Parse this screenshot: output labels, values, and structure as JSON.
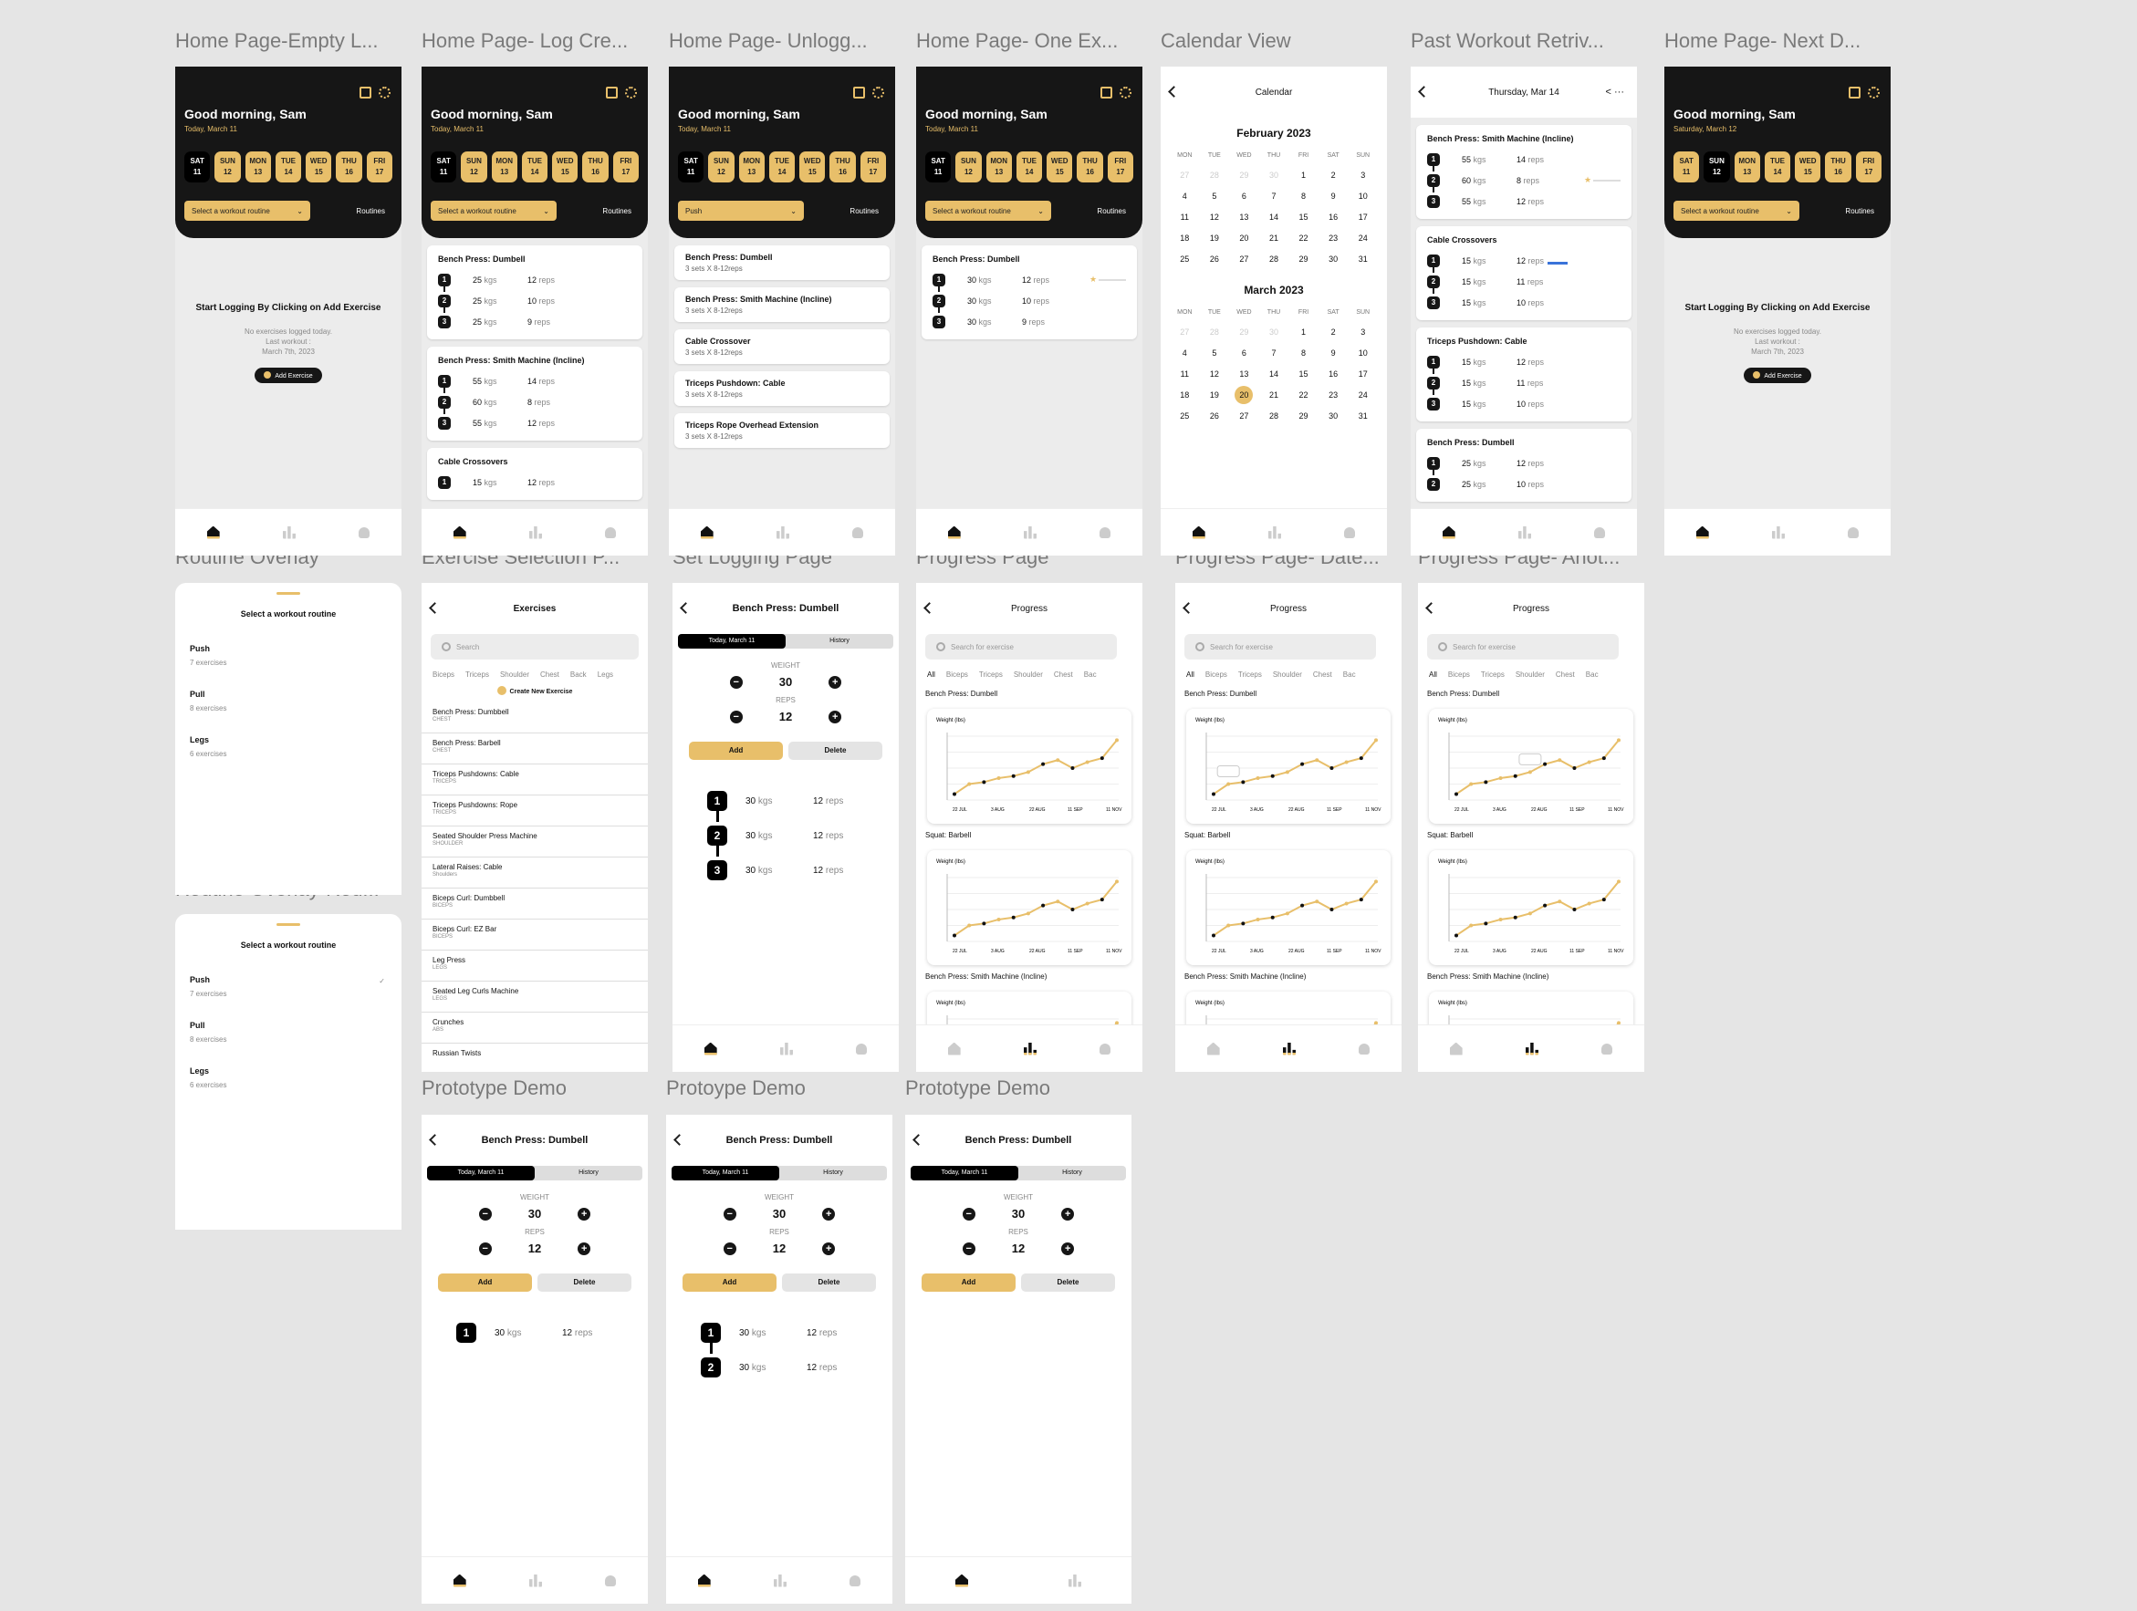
{
  "colors": {
    "accent": "#e8bf6a",
    "dark": "#161616",
    "canvas": "#e5e5e5",
    "progress_blue": "#3a73d9"
  },
  "frame_titles": {
    "home_empty": "Home Page-Empty L...",
    "home_log": "Home Page- Log Cre...",
    "home_unlogged": "Home Page- Unlogg...",
    "home_one": "Home Page- One Ex...",
    "calendar": "Calendar View",
    "past": "Past Workout Retriv...",
    "next": "Home Page- Next D...",
    "routine": "Routine Overlay",
    "routine2": "Routine Overlay-Rou...",
    "exsel": "Exercise Selection P...",
    "setlog": "Set Logging Page",
    "progress": "Progress Page",
    "progress_date": "Progress Page- Date...",
    "progress_other": "Progress Page- Anot...",
    "proto1": "Prototype Demo",
    "proto2": "Protoype Demo",
    "proto3": "Prototype Demo"
  },
  "home": {
    "greeting": "Good morning, Sam",
    "today": "Today, March 11",
    "today_next": "Saturday, March 12",
    "days": [
      {
        "dow": "SAT",
        "num": "11"
      },
      {
        "dow": "SUN",
        "num": "12"
      },
      {
        "dow": "MON",
        "num": "13"
      },
      {
        "dow": "TUE",
        "num": "14"
      },
      {
        "dow": "WED",
        "num": "15"
      },
      {
        "dow": "THU",
        "num": "16"
      },
      {
        "dow": "FRI",
        "num": "17"
      }
    ],
    "select_placeholder": "Select a workout routine",
    "select_push": "Push",
    "routines": "Routines",
    "empty_title": "Start Logging By Clicking on Add Exercise",
    "empty_note": "No exercises logged today.",
    "last_workout": "Last workout :",
    "last_date": "March 7th, 2023",
    "add_exercise": "Add Exercise",
    "unit_kgs": "kgs",
    "unit_reps": "reps"
  },
  "log": [
    {
      "name": "Bench Press: Dumbell",
      "sets": [
        {
          "n": "1",
          "w": "25",
          "r": "12"
        },
        {
          "n": "2",
          "w": "25",
          "r": "10"
        },
        {
          "n": "3",
          "w": "25",
          "r": "9"
        }
      ]
    },
    {
      "name": "Bench Press: Smith Machine (Incline)",
      "sets": [
        {
          "n": "1",
          "w": "55",
          "r": "14"
        },
        {
          "n": "2",
          "w": "60",
          "r": "8"
        },
        {
          "n": "3",
          "w": "55",
          "r": "12"
        }
      ]
    },
    {
      "name": "Cable Crossovers",
      "sets": [
        {
          "n": "1",
          "w": "15",
          "r": "12"
        }
      ]
    }
  ],
  "unlogged": [
    {
      "name": "Bench Press: Dumbell",
      "sub": "3 sets X 8-12reps"
    },
    {
      "name": "Bench Press: Smith Machine (Incline)",
      "sub": "3 sets X 8-12reps"
    },
    {
      "name": "Cable Crossover",
      "sub": "3 sets X 8-12reps"
    },
    {
      "name": "Triceps Pushdown: Cable",
      "sub": "3 sets X 8-12reps"
    },
    {
      "name": "Triceps Rope Overhead Extension",
      "sub": "3 sets X 8-12reps"
    }
  ],
  "one": {
    "name": "Bench Press: Dumbell",
    "sets": [
      {
        "n": "1",
        "w": "30",
        "r": "12"
      },
      {
        "n": "2",
        "w": "30",
        "r": "10"
      },
      {
        "n": "3",
        "w": "30",
        "r": "9"
      }
    ]
  },
  "calendar": {
    "title": "Calendar",
    "dow": [
      "MON",
      "TUE",
      "WED",
      "THU",
      "FRI",
      "SAT",
      "SUN"
    ],
    "months": [
      {
        "name": "February 2023",
        "days": [
          "27",
          "28",
          "29",
          "30",
          "1",
          "2",
          "3",
          "4",
          "5",
          "6",
          "7",
          "8",
          "9",
          "10",
          "11",
          "12",
          "13",
          "14",
          "15",
          "16",
          "17",
          "18",
          "19",
          "20",
          "21",
          "22",
          "23",
          "24",
          "25",
          "26",
          "27",
          "28",
          "29",
          "30",
          "31"
        ]
      },
      {
        "name": "March 2023",
        "days": [
          "27",
          "28",
          "29",
          "30",
          "1",
          "2",
          "3",
          "4",
          "5",
          "6",
          "7",
          "8",
          "9",
          "10",
          "11",
          "12",
          "13",
          "14",
          "15",
          "16",
          "17",
          "18",
          "19",
          "20",
          "21",
          "22",
          "23",
          "24",
          "25",
          "26",
          "27",
          "28",
          "29",
          "30",
          "31"
        ]
      }
    ]
  },
  "past": {
    "title": "Thursday, Mar 14",
    "cards": [
      {
        "name": "Bench Press: Smith Machine (Incline)",
        "sets": [
          {
            "n": "1",
            "w": "55",
            "r": "14"
          },
          {
            "n": "2",
            "w": "60",
            "r": "8"
          },
          {
            "n": "3",
            "w": "55",
            "r": "12"
          }
        ]
      },
      {
        "name": "Cable Crossovers",
        "sets": [
          {
            "n": "1",
            "w": "15",
            "r": "12"
          },
          {
            "n": "2",
            "w": "15",
            "r": "11"
          },
          {
            "n": "3",
            "w": "15",
            "r": "10"
          }
        ]
      },
      {
        "name": "Triceps Pushdown: Cable",
        "sets": [
          {
            "n": "1",
            "w": "15",
            "r": "12"
          },
          {
            "n": "2",
            "w": "15",
            "r": "11"
          },
          {
            "n": "3",
            "w": "15",
            "r": "10"
          }
        ]
      },
      {
        "name": "Bench Press: Dumbell",
        "sets": [
          {
            "n": "1",
            "w": "25",
            "r": "12"
          },
          {
            "n": "2",
            "w": "25",
            "r": "10"
          }
        ]
      }
    ]
  },
  "routine": {
    "title": "Select a workout routine",
    "options": [
      {
        "name": "Push",
        "sub": "7 exercises"
      },
      {
        "name": "Pull",
        "sub": "8 exercises"
      },
      {
        "name": "Legs",
        "sub": "6 exercises"
      }
    ]
  },
  "exercises": {
    "title": "Exercises",
    "search": "Search",
    "filters": [
      "Biceps",
      "Triceps",
      "Shoulder",
      "Chest",
      "Back",
      "Legs"
    ],
    "create": "Create New Exercise",
    "items": [
      {
        "name": "Bench Press: Dumbbell",
        "cat": "CHEST"
      },
      {
        "name": "Bench Press: Barbell",
        "cat": "CHEST"
      },
      {
        "name": "Triceps Pushdowns: Cable",
        "cat": "TRICEPS"
      },
      {
        "name": "Triceps Pushdowns: Rope",
        "cat": "TRICEPS"
      },
      {
        "name": "Seated Shoulder Press Machine",
        "cat": "SHOULDER"
      },
      {
        "name": "Lateral Raises: Cable",
        "cat": "Shoulders"
      },
      {
        "name": "Biceps Curl: Dumbbell",
        "cat": "BICEPS"
      },
      {
        "name": "Biceps Curl: EZ Bar",
        "cat": "BICEPS"
      },
      {
        "name": "Leg Press",
        "cat": "LEGS"
      },
      {
        "name": "Seated Leg Curls Machine",
        "cat": "LEGS"
      },
      {
        "name": "Crunches",
        "cat": "ABS"
      },
      {
        "name": "Russian Twists",
        "cat": ""
      }
    ]
  },
  "setlog": {
    "title": "Bench Press: Dumbell",
    "tab_today": "Today, March 11",
    "tab_history": "History",
    "weight_label": "WEIGHT",
    "weight": "30",
    "reps_label": "REPS",
    "reps": "12",
    "add": "Add",
    "delete": "Delete",
    "sets": [
      {
        "n": "1",
        "w": "30",
        "r": "12"
      },
      {
        "n": "2",
        "w": "30",
        "r": "12"
      },
      {
        "n": "3",
        "w": "30",
        "r": "12"
      }
    ]
  },
  "progress": {
    "title": "Progress",
    "search": "Search for exercise",
    "filters": [
      "All",
      "Biceps",
      "Triceps",
      "Shoulder",
      "Chest",
      "Bac"
    ],
    "sections": [
      "Bench Press: Dumbell",
      "Squat: Barbell",
      "Bench Press: Smith Machine (Incline)"
    ],
    "chart_label": "Weight (lbs)",
    "x_ticks": [
      "22 JUL",
      "3 AUG",
      "22 AUG",
      "11 SEP",
      "11 NOV"
    ]
  },
  "chart_data": [
    {
      "type": "line",
      "title": "",
      "ylabel": "Weight (lbs)",
      "x": [
        "22 JUL",
        "3 AUG",
        "22 AUG",
        "11 SEP",
        "11 NOV"
      ],
      "series": [
        {
          "values": [
            15,
            40,
            45,
            55,
            60,
            70,
            90,
            100,
            80,
            95,
            105,
            150
          ]
        }
      ]
    }
  ]
}
